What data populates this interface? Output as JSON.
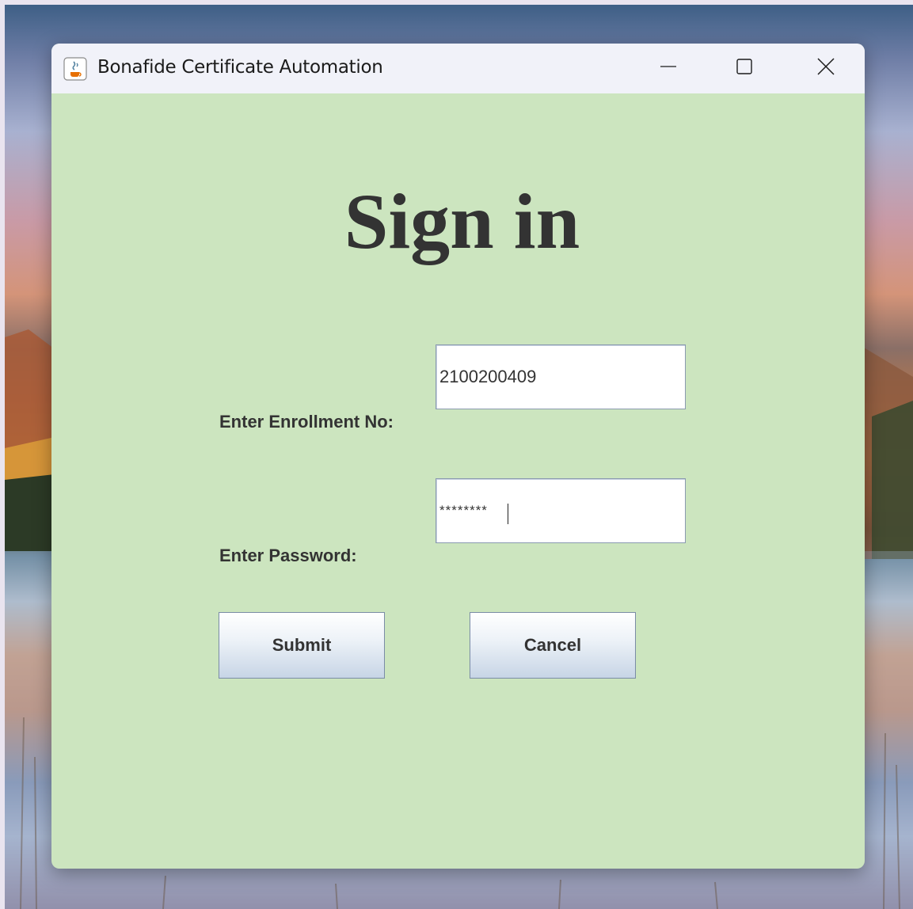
{
  "window": {
    "title": "Bonafide Certificate Automation",
    "app_icon": "java-cup-icon",
    "controls": {
      "minimize_icon": "minimize-icon",
      "maximize_icon": "maximize-icon",
      "close_icon": "close-icon"
    }
  },
  "form": {
    "heading": "Sign in",
    "enrollment": {
      "label": "Enter Enrollment No:",
      "value": "2100200409"
    },
    "password": {
      "label": "Enter Password:",
      "masked_value": "********"
    },
    "buttons": {
      "submit_label": "Submit",
      "cancel_label": "Cancel"
    }
  },
  "colors": {
    "panel_background": "#cce5bf",
    "title_bar": "#f1f2f9",
    "text": "#333333"
  }
}
